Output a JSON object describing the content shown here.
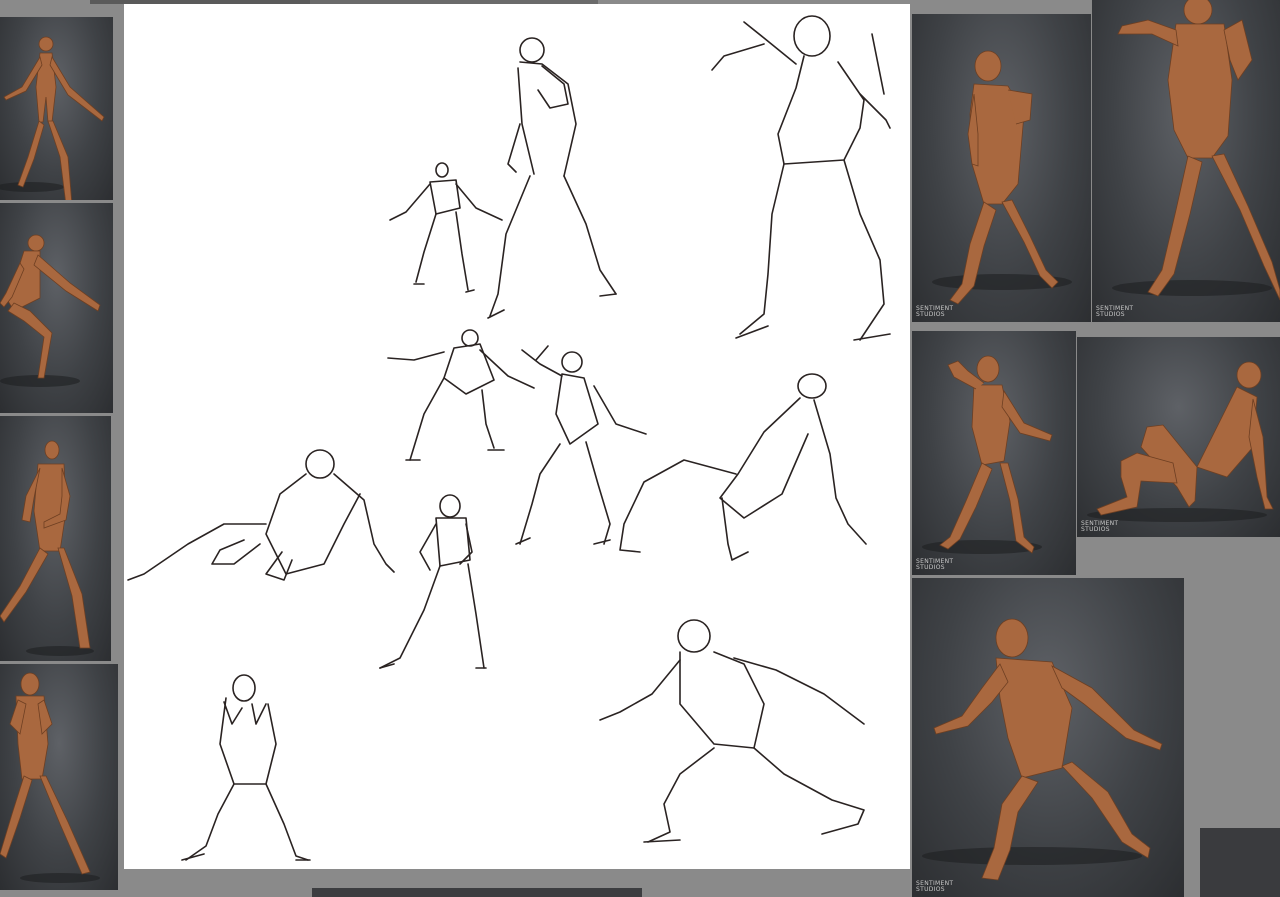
{
  "window": {
    "canvas_background": "#ffffff",
    "workspace_background": "#8a8a8a",
    "sketch_ink": "#2a2322",
    "skin_tone": "#a9683f"
  },
  "references": {
    "studio_logo_text": "SENTIMENT\nSTUDIOS"
  }
}
